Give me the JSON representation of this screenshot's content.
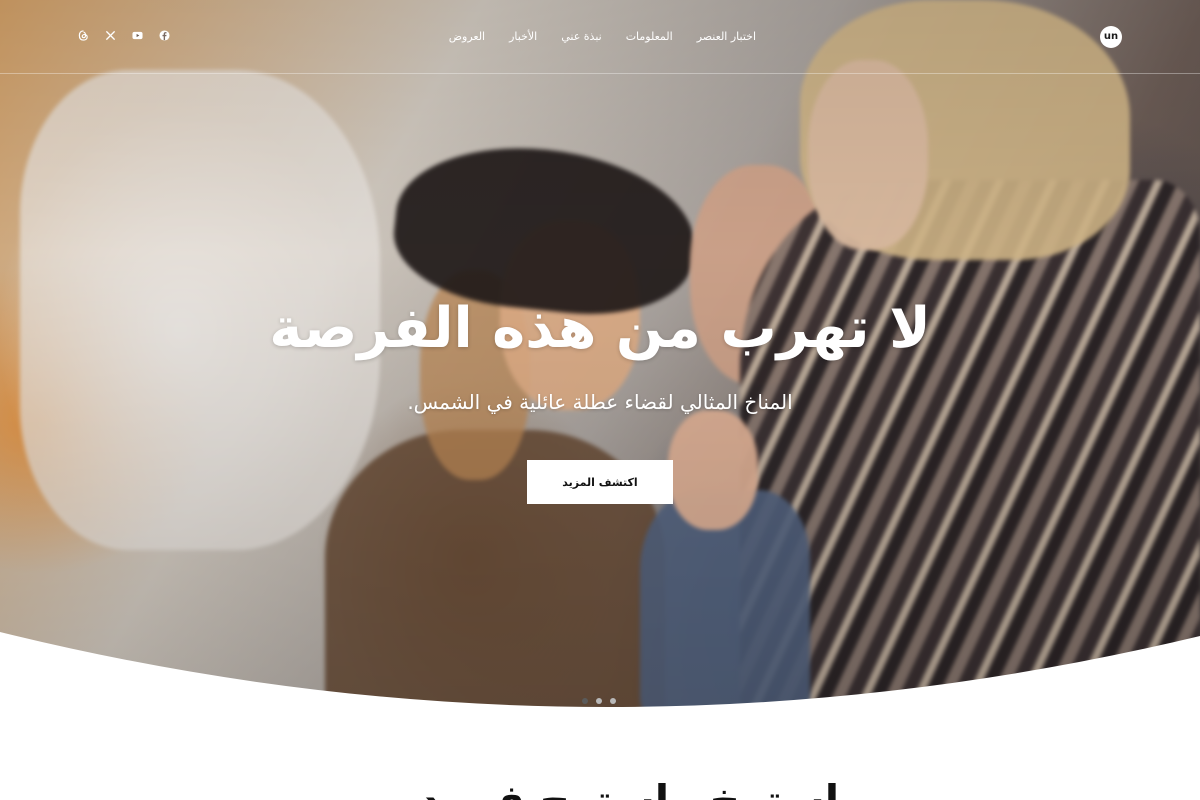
{
  "brand": {
    "logo_text": "un"
  },
  "nav": {
    "items": [
      {
        "label": "اختبار العنصر"
      },
      {
        "label": "المعلومات"
      },
      {
        "label": "نبذة عني"
      },
      {
        "label": "الأخبار"
      },
      {
        "label": "العروض"
      }
    ]
  },
  "social": {
    "icons": [
      "facebook-icon",
      "youtube-icon",
      "x-icon",
      "threads-icon"
    ]
  },
  "hero": {
    "title": "لا تهرب من هذه الفرصة",
    "subtitle": "المناخ المثالي لقضاء عطلة عائلية في الشمس.",
    "cta_label": "اكتشف المزيد",
    "slides": {
      "count": 3,
      "active_index": 0
    }
  },
  "section": {
    "heading": "استرخ واسترح في دبي"
  },
  "colors": {
    "hero_text": "#ffffff",
    "button_bg": "#ffffff",
    "button_text": "#111111",
    "page_bg": "#ffffff",
    "heading_text": "#111111"
  }
}
